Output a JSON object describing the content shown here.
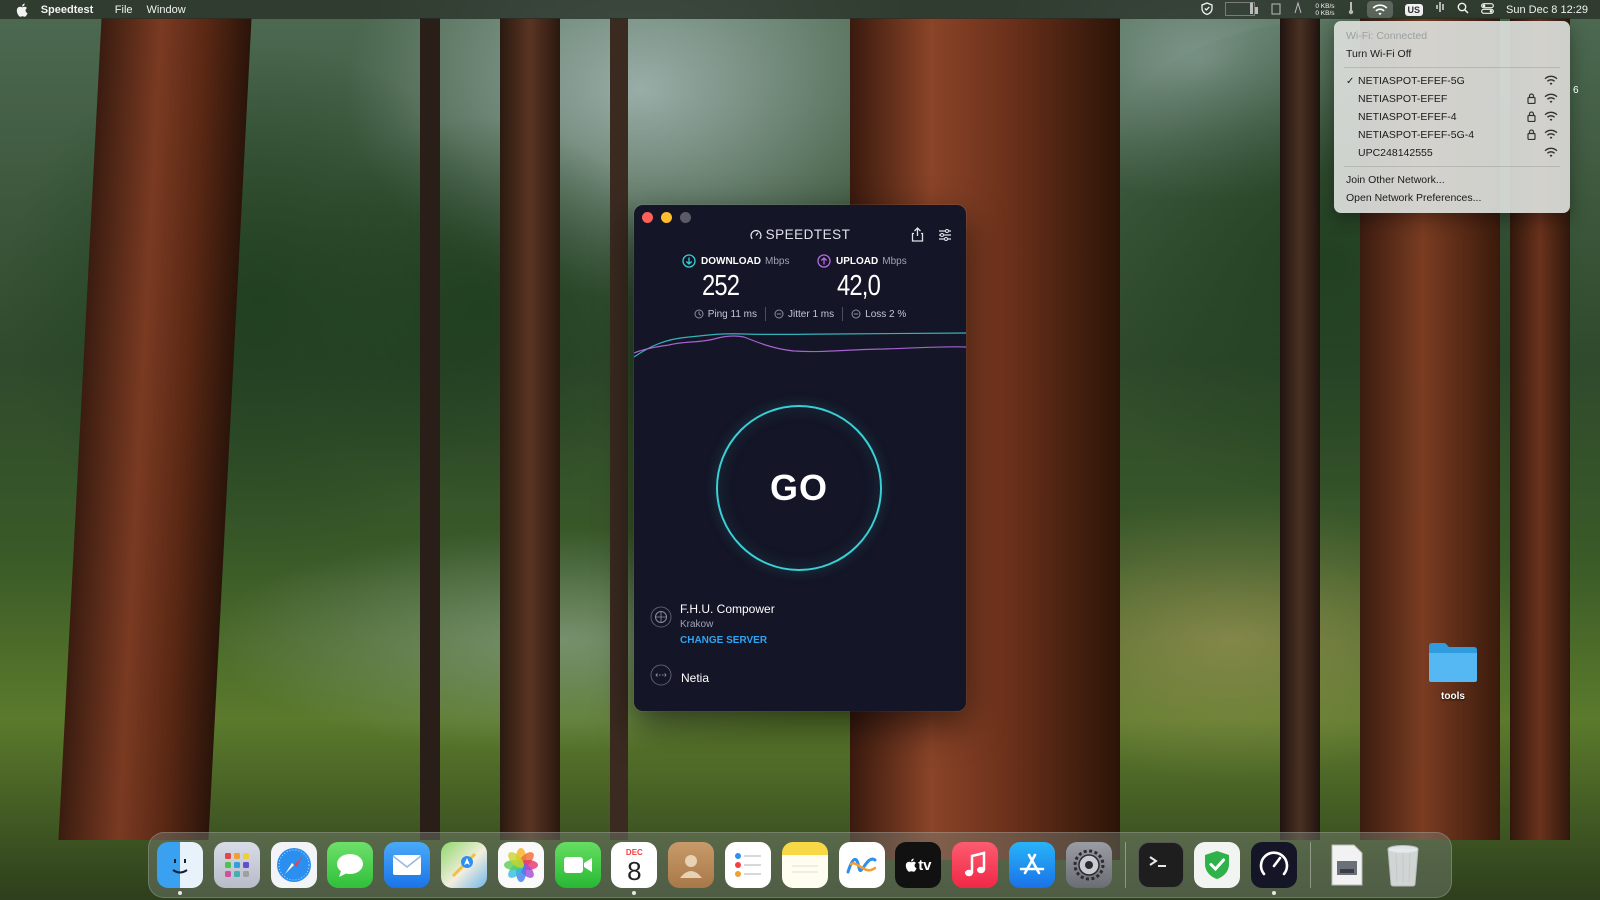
{
  "menubar": {
    "app_name": "Speedtest",
    "menus": [
      "File",
      "Window"
    ],
    "net_up": "0 KB/s",
    "net_down": "0 KB/s",
    "input_source": "US",
    "clock": "Sun Dec 8  12:29"
  },
  "wifi_menu": {
    "status": "Wi-Fi: Connected",
    "toggle": "Turn Wi-Fi Off",
    "networks": [
      {
        "name": "NETIASPOT-EFEF-5G",
        "connected": true,
        "locked": false
      },
      {
        "name": "NETIASPOT-EFEF",
        "connected": false,
        "locked": true
      },
      {
        "name": "NETIASPOT-EFEF-4",
        "connected": false,
        "locked": true
      },
      {
        "name": "NETIASPOT-EFEF-5G-4",
        "connected": false,
        "locked": true
      },
      {
        "name": "UPC248142555",
        "connected": false,
        "locked": false
      }
    ],
    "join_other": "Join Other Network...",
    "open_prefs": "Open Network Preferences..."
  },
  "speedtest": {
    "title": "SPEEDTEST",
    "download": {
      "label": "DOWNLOAD",
      "unit": "Mbps",
      "value": "252"
    },
    "upload": {
      "label": "UPLOAD",
      "unit": "Mbps",
      "value": "42,0"
    },
    "ping": "Ping 11 ms",
    "jitter": "Jitter 1 ms",
    "loss": "Loss 2 %",
    "go_label": "GO",
    "server": {
      "name": "F.H.U. Compower",
      "city": "Krakow",
      "change": "CHANGE SERVER"
    },
    "isp": "Netia",
    "colors": {
      "accent_cyan": "#3ad0d5",
      "download": "#3ad0d5",
      "upload": "#b56ce0",
      "link": "#2fa4f2",
      "background": "#141526"
    }
  },
  "desktop": {
    "folder_label": "tools",
    "stray_text": "6"
  },
  "dock": {
    "apps": [
      "finder-icon",
      "launchpad-icon",
      "safari-icon",
      "messages-icon",
      "mail-icon",
      "maps-icon",
      "photos-icon",
      "facetime-icon",
      "calendar-icon",
      "contacts-icon",
      "reminders-icon",
      "notes-icon",
      "freeform-icon",
      "tv-icon",
      "music-icon",
      "app-store-icon",
      "system-settings-icon",
      "terminal-icon",
      "vpn-shield-icon",
      "speedtest-icon",
      "preview-icon",
      "trash-icon"
    ],
    "calendar_month": "DEC",
    "calendar_day": "8",
    "tv_label": "tv"
  }
}
